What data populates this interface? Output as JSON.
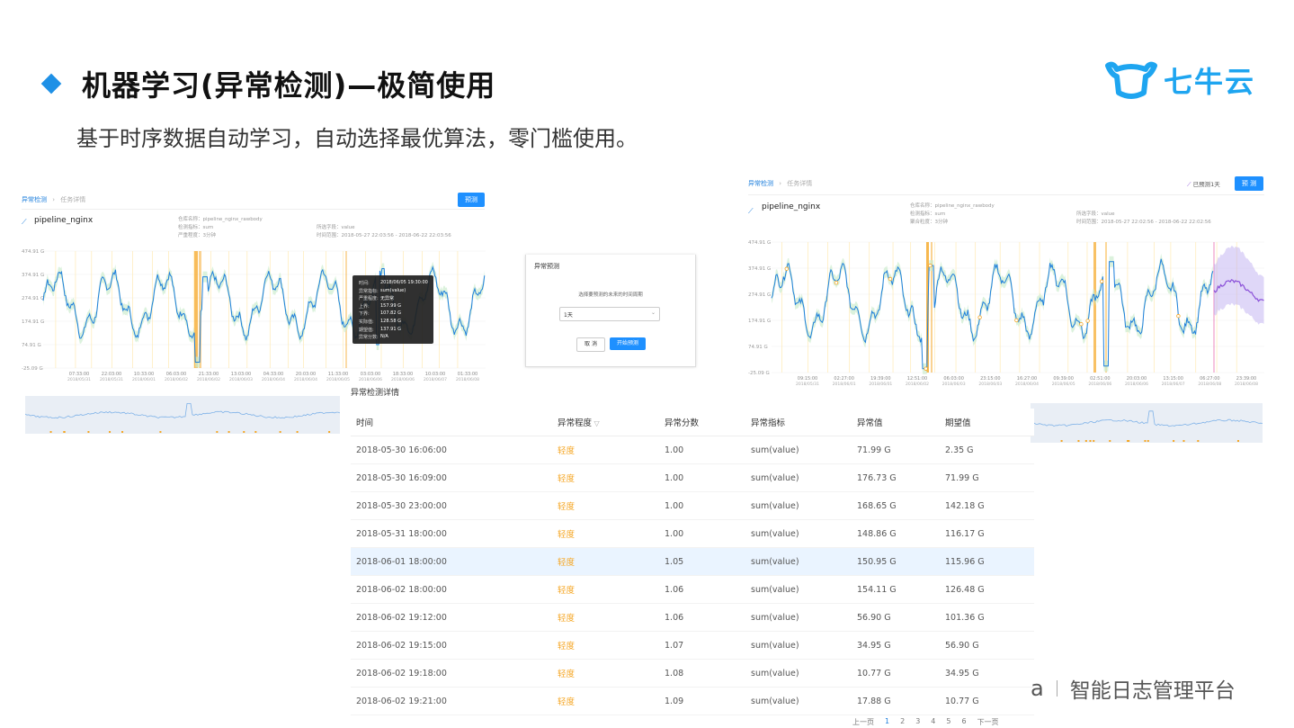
{
  "slide": {
    "title": "机器学习(异常检测)—极简使用",
    "subtitle": "基于时序数据自动学习，自动选择最优算法，零门槛使用。",
    "logo_text": "七牛云",
    "footer_a": "a",
    "footer_text": "智能日志管理平台"
  },
  "left_panel": {
    "crumb_root": "异常检测",
    "crumb_current": "任务详情",
    "predict_btn": "预测",
    "name": "pipeline_nginx",
    "meta": [
      "仓库名称：pipeline_nginx_rawbody",
      "检测指标：sum",
      "严重程度：3分钟"
    ],
    "meta2": [
      "所选字段：value",
      "时间范围：2018-05-27 22:03:56 - 2018-06-22 22:03:56"
    ],
    "y_ticks": [
      "474.91 G",
      "374.91 G",
      "274.91 G",
      "174.91 G",
      "74.91 G",
      "-25.09 G"
    ],
    "x_ticks": [
      "07:33:00",
      "22:03:00",
      "10:33:00",
      "06:03:00",
      "21:33:00",
      "13:03:00",
      "04:33:00",
      "20:03:00",
      "11:33:00",
      "03:03:00",
      "18:33:00",
      "10:03:00",
      "01:33:00"
    ],
    "x_dates": [
      "2018/05/31",
      "2018/05/31",
      "2018/06/01",
      "2018/06/02",
      "2018/06/02",
      "2018/06/03",
      "2018/06/04",
      "2018/06/04",
      "2018/06/05",
      "2018/06/06",
      "2018/06/06",
      "2018/06/07",
      "2018/06/08"
    ]
  },
  "tooltip": {
    "rows": [
      {
        "k": "时间:",
        "v": "2018/06/05 19:30:00"
      },
      {
        "k": "异常指标:",
        "v": "sum(value)"
      },
      {
        "k": "严重程度:",
        "v": "无异常"
      },
      {
        "k": "上界:",
        "v": "157.99 G"
      },
      {
        "k": "下界:",
        "v": "107.82 G"
      },
      {
        "k": "实际值:",
        "v": "128.58 G"
      },
      {
        "k": "期望值:",
        "v": "137.91 G"
      },
      {
        "k": "异常分数:",
        "v": "N/A"
      }
    ]
  },
  "modal": {
    "title": "异常预测",
    "question": "选择要预测的未来的时间周期",
    "select_value": "1天",
    "cancel": "取 消",
    "start": "开始预测"
  },
  "right_panel": {
    "crumb_root": "异常检测",
    "crumb_current": "任务详情",
    "predicted_label": "已预测1天",
    "predict_btn": "预 测",
    "name": "pipeline_nginx",
    "meta": [
      "仓库名称：pipeline_nginx_rawbody",
      "检测指标：sum",
      "聚合粒度：3分钟"
    ],
    "meta2": [
      "所选字段：value",
      "时间范围：2018-05-27 22:02:56 - 2018-06-22 22:02:56"
    ],
    "y_ticks": [
      "474.91 G",
      "374.91 G",
      "274.91 G",
      "174.91 G",
      "74.91 G",
      "-25.09 G"
    ],
    "x_ticks": [
      "09:15:00",
      "02:27:00",
      "19:39:00",
      "12:51:00",
      "06:03:00",
      "23:15:00",
      "16:27:00",
      "09:39:00",
      "02:51:00",
      "20:03:00",
      "13:15:00",
      "06:27:00",
      "23:39:00"
    ],
    "x_dates": [
      "2018/05/31",
      "2018/06/01",
      "2018/06/01",
      "2018/06/02",
      "2018/06/03",
      "2018/06/03",
      "2018/06/04",
      "2018/06/05",
      "2018/06/06",
      "2018/06/06",
      "2018/06/07",
      "2018/06/08",
      "2018/06/08"
    ]
  },
  "table": {
    "caption": "异常检测详情",
    "headers": [
      "时间",
      "异常程度",
      "异常分数",
      "异常指标",
      "异常值",
      "期望值"
    ],
    "filter_icon": "filter-icon",
    "rows": [
      [
        "2018-05-30 16:06:00",
        "轻度",
        "1.00",
        "sum(value)",
        "71.99 G",
        "2.35 G"
      ],
      [
        "2018-05-30 16:09:00",
        "轻度",
        "1.00",
        "sum(value)",
        "176.73 G",
        "71.99 G"
      ],
      [
        "2018-05-30 23:00:00",
        "轻度",
        "1.00",
        "sum(value)",
        "168.65 G",
        "142.18 G"
      ],
      [
        "2018-05-31 18:00:00",
        "轻度",
        "1.00",
        "sum(value)",
        "148.86 G",
        "116.17 G"
      ],
      [
        "2018-06-01 18:00:00",
        "轻度",
        "1.05",
        "sum(value)",
        "150.95 G",
        "115.96 G"
      ],
      [
        "2018-06-02 18:00:00",
        "轻度",
        "1.06",
        "sum(value)",
        "154.11 G",
        "126.48 G"
      ],
      [
        "2018-06-02 19:12:00",
        "轻度",
        "1.06",
        "sum(value)",
        "56.90 G",
        "101.36 G"
      ],
      [
        "2018-06-02 19:15:00",
        "轻度",
        "1.07",
        "sum(value)",
        "34.95 G",
        "56.90 G"
      ],
      [
        "2018-06-02 19:18:00",
        "轻度",
        "1.08",
        "sum(value)",
        "10.77 G",
        "34.95 G"
      ],
      [
        "2018-06-02 19:21:00",
        "轻度",
        "1.09",
        "sum(value)",
        "17.88 G",
        "10.77 G"
      ]
    ],
    "highlight_row": 4
  },
  "pager": {
    "prev": "上一页",
    "pages": [
      "1",
      "2",
      "3",
      "4",
      "5",
      "6"
    ],
    "active": "1",
    "next": "下一页"
  },
  "colors": {
    "accent": "#1e90e6",
    "line": "#1e7fdc",
    "band": "#cdeccf",
    "anomaly": "#f5a623",
    "forecast": "#8a4fd8"
  }
}
